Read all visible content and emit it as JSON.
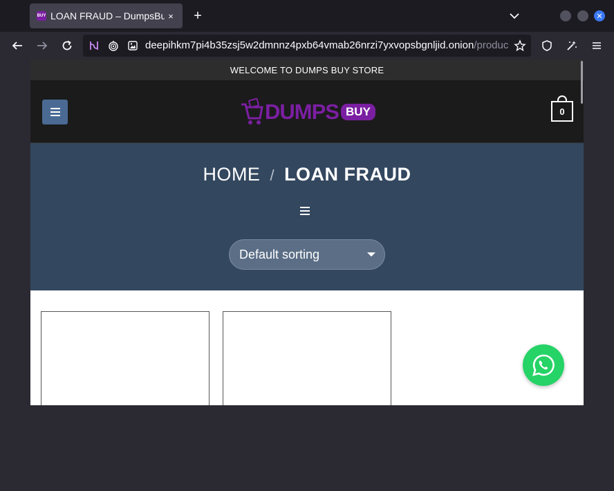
{
  "browser": {
    "tab": {
      "favicon_text": "BUY",
      "title": "LOAN FRAUD – DumpsBuy",
      "close_glyph": "×"
    },
    "new_tab_glyph": "+",
    "url": {
      "main": "deepihkm7pi4b35zsj5w2dmnnz4pxb64vmab26nrzi7yxvopsbgnljid.onion",
      "tail": "/product-category/loan-fraud/"
    },
    "icons": [
      "back-icon",
      "forward-icon",
      "reload-icon",
      "tor-circuit-icon",
      "onion-icon",
      "page-info-icon",
      "bookmark-star-icon",
      "shield-icon",
      "extensions-icon",
      "hamburger-menu-icon"
    ]
  },
  "site": {
    "announcement": "WELCOME TO DUMPS BUY STORE",
    "logo": {
      "word": "DUMPS",
      "badge": "BUY"
    },
    "cart_count": "0",
    "breadcrumb": {
      "home": "HOME",
      "separator": "/",
      "current": "LOAN FRAUD"
    },
    "sort": {
      "selected": "Default sorting"
    },
    "colors": {
      "brand": "#7b1fa2",
      "hero": "#33475f",
      "menu_button": "#4a6a94",
      "whatsapp": "#25d366"
    }
  }
}
